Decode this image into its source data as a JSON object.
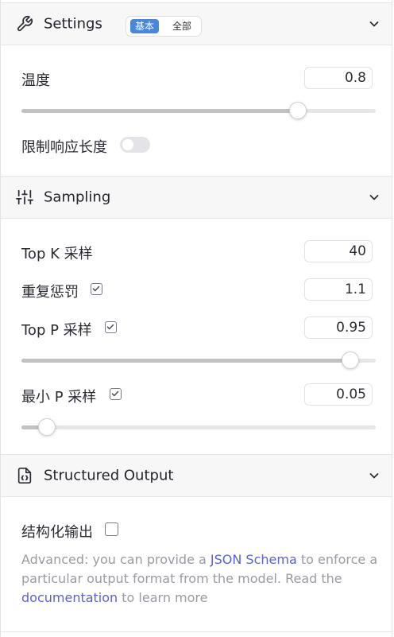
{
  "settings": {
    "title": "Settings",
    "segment": {
      "basic": "基本",
      "all": "全部"
    },
    "temperature": {
      "label": "温度",
      "value": "0.8",
      "fraction": 0.78
    },
    "limit_length": {
      "label": "限制响应长度",
      "on": false
    }
  },
  "sampling": {
    "title": "Sampling",
    "top_k": {
      "label": "Top K 采样",
      "value": "40"
    },
    "repeat_penalty": {
      "label": "重复惩罚",
      "value": "1.1",
      "checked": true
    },
    "top_p": {
      "label": "Top P 采样",
      "value": "0.95",
      "checked": true,
      "fraction": 0.928
    },
    "min_p": {
      "label": "最小 P 采样",
      "value": "0.05",
      "checked": true,
      "fraction": 0.072
    }
  },
  "structured": {
    "title": "Structured Output",
    "label": "结构化输出",
    "checked": false,
    "help_pre": "Advanced: you can provide a ",
    "help_link1": "JSON Schema",
    "help_mid": " to enforce a particular output format from the model. Read the ",
    "help_link2": "documentation",
    "help_post": " to learn more"
  },
  "colors": {
    "accent": "#4a86d9",
    "link": "#5b63c9"
  }
}
